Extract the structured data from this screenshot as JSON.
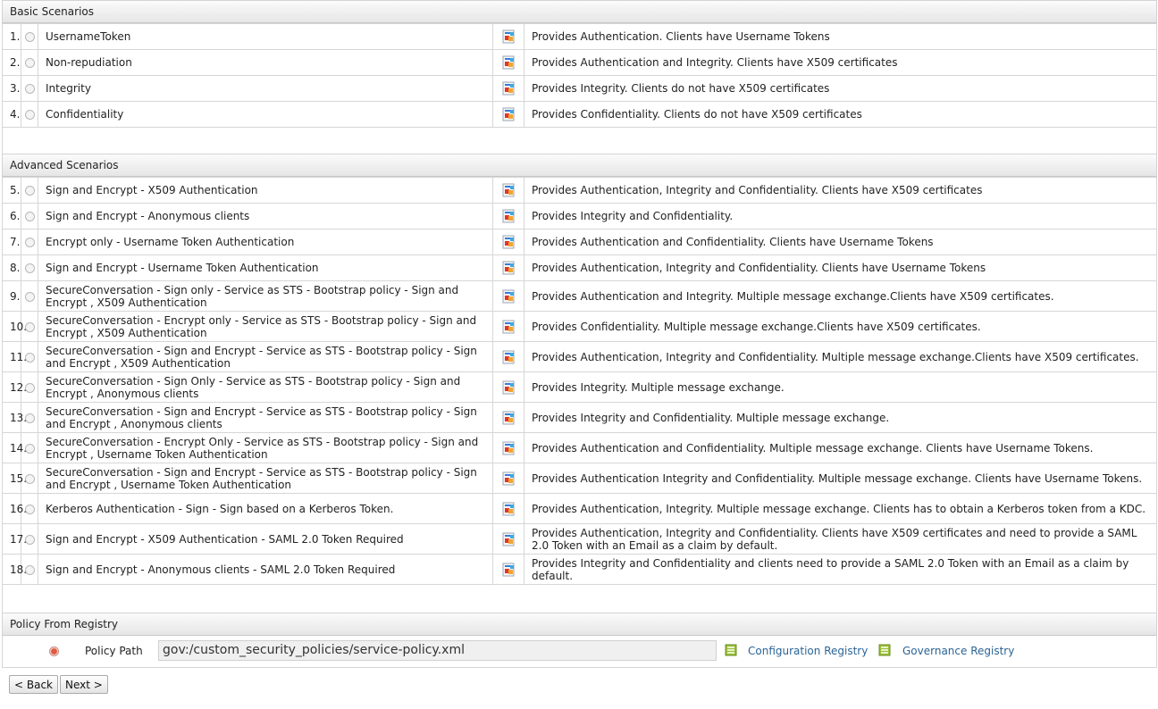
{
  "basic": {
    "title": "Basic Scenarios",
    "rows": [
      {
        "num": "1.",
        "name": "UsernameToken",
        "desc": "Provides Authentication. Clients have Username Tokens"
      },
      {
        "num": "2.",
        "name": "Non-repudiation",
        "desc": "Provides Authentication and Integrity. Clients have X509 certificates"
      },
      {
        "num": "3.",
        "name": "Integrity",
        "desc": "Provides Integrity. Clients do not have X509 certificates"
      },
      {
        "num": "4.",
        "name": "Confidentiality",
        "desc": "Provides Confidentiality. Clients do not have X509 certificates"
      }
    ]
  },
  "advanced": {
    "title": "Advanced Scenarios",
    "rows": [
      {
        "num": "5.",
        "name": "Sign and Encrypt - X509 Authentication",
        "desc": "Provides Authentication, Integrity and Confidentiality. Clients have X509 certificates"
      },
      {
        "num": "6.",
        "name": "Sign and Encrypt - Anonymous clients",
        "desc": "Provides Integrity and Confidentiality."
      },
      {
        "num": "7.",
        "name": "Encrypt only - Username Token Authentication",
        "desc": "Provides Authentication and Confidentiality. Clients have Username Tokens"
      },
      {
        "num": "8.",
        "name": "Sign and Encrypt - Username Token Authentication",
        "desc": "Provides Authentication, Integrity and Confidentiality. Clients have Username Tokens"
      },
      {
        "num": "9.",
        "name": "SecureConversation - Sign only - Service as STS - Bootstrap policy - Sign and Encrypt , X509 Authentication",
        "desc": "Provides Authentication and Integrity. Multiple message exchange.Clients have X509 certificates."
      },
      {
        "num": "10.",
        "name": "SecureConversation - Encrypt only - Service as STS - Bootstrap policy - Sign and Encrypt , X509 Authentication",
        "desc": "Provides Confidentiality. Multiple message exchange.Clients have X509 certificates."
      },
      {
        "num": "11.",
        "name": "SecureConversation - Sign and Encrypt - Service as STS - Bootstrap policy - Sign and Encrypt , X509 Authentication",
        "desc": "Provides Authentication, Integrity and Confidentiality. Multiple message exchange.Clients have X509 certificates."
      },
      {
        "num": "12.",
        "name": "SecureConversation - Sign Only - Service as STS - Bootstrap policy - Sign and Encrypt , Anonymous clients",
        "desc": "Provides Integrity. Multiple message exchange."
      },
      {
        "num": "13.",
        "name": "SecureConversation - Sign and Encrypt - Service as STS - Bootstrap policy - Sign and Encrypt , Anonymous clients",
        "desc": "Provides Integrity and Confidentiality. Multiple message exchange."
      },
      {
        "num": "14.",
        "name": "SecureConversation - Encrypt Only - Service as STS - Bootstrap policy - Sign and Encrypt , Username Token Authentication",
        "desc": "Provides Authentication and Confidentiality. Multiple message exchange. Clients have Username Tokens."
      },
      {
        "num": "15.",
        "name": "SecureConversation - Sign and Encrypt - Service as STS - Bootstrap policy - Sign and Encrypt , Username Token Authentication",
        "desc": "Provides Authentication Integrity and Confidentiality. Multiple message exchange. Clients have Username Tokens."
      },
      {
        "num": "16.",
        "name": "Kerberos Authentication - Sign - Sign based on a Kerberos Token.",
        "desc": "Provides Authentication, Integrity. Multiple message exchange. Clients has to obtain a Kerberos token from a KDC."
      },
      {
        "num": "17.",
        "name": "Sign and Encrypt - X509 Authentication - SAML 2.0 Token Required",
        "desc": "Provides Authentication, Integrity and Confidentiality. Clients have X509 certificates and need to provide a SAML 2.0 Token with an Email as a claim by default."
      },
      {
        "num": "18.",
        "name": "Sign and Encrypt - Anonymous clients - SAML 2.0 Token Required",
        "desc": "Provides Integrity and Confidentiality and clients need to provide a SAML 2.0 Token with an Email as a claim by default."
      }
    ]
  },
  "registry": {
    "title": "Policy From Registry",
    "policy_label": "Policy Path",
    "policy_path": "gov:/custom_security_policies/service-policy.xml",
    "config_link": "Configuration Registry",
    "gov_link": "Governance Registry",
    "selected": true
  },
  "buttons": {
    "back": "< Back",
    "next": "Next >"
  },
  "icons": {
    "policy": "policy-view-icon",
    "registry": "registry-browse-icon"
  }
}
